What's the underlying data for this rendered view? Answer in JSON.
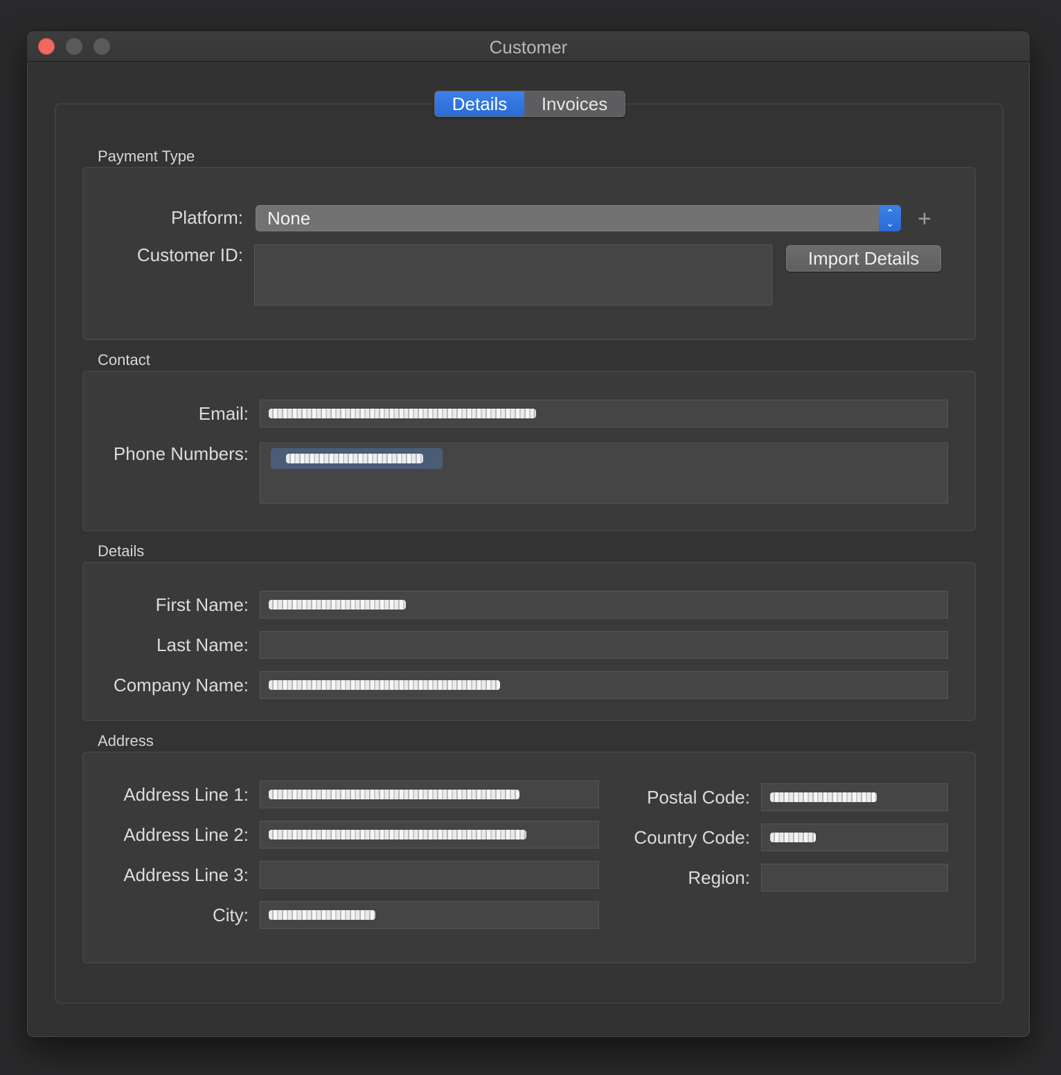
{
  "window": {
    "title": "Customer"
  },
  "tabs": [
    {
      "label": "Details",
      "active": true
    },
    {
      "label": "Invoices",
      "active": false
    }
  ],
  "payment_type": {
    "group_label": "Payment Type",
    "platform_label": "Platform:",
    "platform_value": "None",
    "customer_id_label": "Customer ID:",
    "customer_id_value": "",
    "import_button": "Import Details",
    "add_icon": "+"
  },
  "contact": {
    "group_label": "Contact",
    "email_label": "Email:",
    "phone_label": "Phone Numbers:"
  },
  "details": {
    "group_label": "Details",
    "first_name_label": "First Name:",
    "last_name_label": "Last Name:",
    "company_label": "Company Name:"
  },
  "address": {
    "group_label": "Address",
    "line1_label": "Address Line 1:",
    "line2_label": "Address Line 2:",
    "line3_label": "Address Line 3:",
    "city_label": "City:",
    "postal_label": "Postal Code:",
    "country_label": "Country Code:",
    "region_label": "Region:"
  },
  "colors": {
    "accent": "#2a6bd6",
    "close": "#ed6a5e",
    "window_bg": "#323232"
  }
}
